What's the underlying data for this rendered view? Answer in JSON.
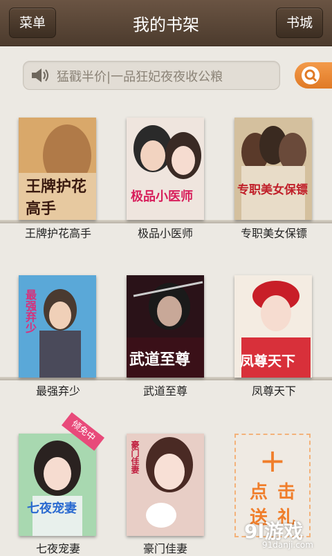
{
  "header": {
    "menu_label": "菜单",
    "title": "我的书架",
    "store_label": "书城"
  },
  "notice": {
    "text": "猛戳半价|一品狂妃夜夜收公粮"
  },
  "books": [
    {
      "label": "王牌护花高手",
      "cover_title": "王牌\n护花高手",
      "color": "#d9a86a"
    },
    {
      "label": "极品小医师",
      "cover_title": "极品小医师",
      "color": "#e8d8d0"
    },
    {
      "label": "专职美女保镖",
      "cover_title": "专职美女保镖",
      "color": "#c8b08a"
    },
    {
      "label": "最强弃少",
      "cover_title": "最强弃少",
      "color": "#4aa0d8"
    },
    {
      "label": "武道至尊",
      "cover_title": "武道至尊",
      "color": "#3a1a22"
    },
    {
      "label": "凤尊天下",
      "cover_title": "凤尊天下",
      "color": "#d83a3a"
    },
    {
      "label": "七夜宠妻",
      "cover_title": "七夜宠妻",
      "color": "#9ed0a8"
    },
    {
      "label": "豪门佳妻",
      "cover_title": "豪门佳妻",
      "color": "#e6c8c0"
    }
  ],
  "add_tile": {
    "plus": "+",
    "text": "点击送礼"
  },
  "badge": "倾免中",
  "watermark": {
    "logo": "9l游戏",
    "site": "91danji.com"
  },
  "colors": {
    "accent": "#f07e2b",
    "topbar": "#5a4636"
  }
}
